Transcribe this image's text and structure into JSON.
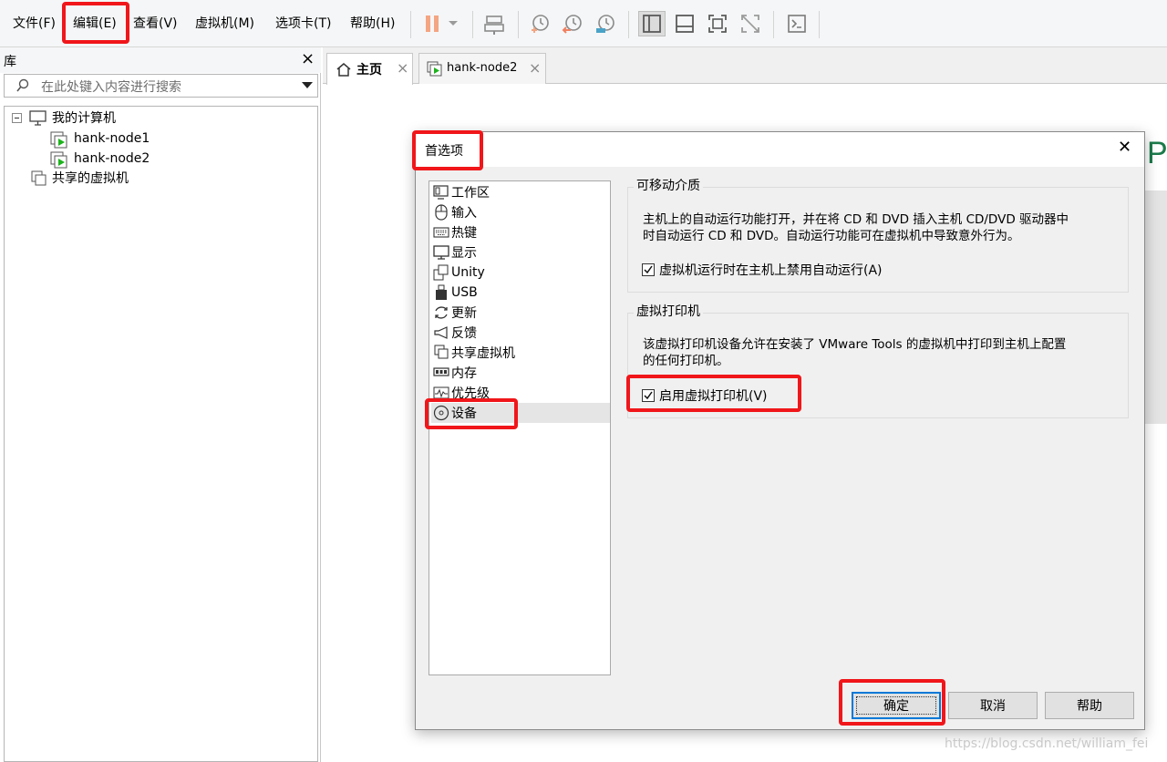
{
  "menubar": {
    "items": [
      "文件(F)",
      "编辑(E)",
      "查看(V)",
      "虚拟机(M)",
      "选项卡(T)",
      "帮助(H)"
    ]
  },
  "toolbar": {
    "icons": [
      "pause-icon",
      "dropdown-arrow-icon",
      "send-ctrl-alt-del-icon",
      "snapshot-icon",
      "revert-snapshot-icon",
      "snapshot-manager-icon",
      "show-library-icon",
      "thumbnail-bar-icon",
      "full-screen-icon",
      "unity-icon",
      "console-icon"
    ]
  },
  "library": {
    "title": "库",
    "close": "×",
    "search_placeholder": "在此处键入内容进行搜索",
    "tree": {
      "root": "我的计算机",
      "vms": [
        "hank-node1",
        "hank-node2"
      ],
      "shared": "共享的虚拟机"
    }
  },
  "tabs": [
    {
      "label": "主页",
      "close": "×"
    },
    {
      "label": "hank-node2",
      "close": "×"
    }
  ],
  "dialog": {
    "title": "首选项",
    "close": "✕",
    "categories": [
      "工作区",
      "输入",
      "热键",
      "显示",
      "Unity",
      "USB",
      "更新",
      "反馈",
      "共享虚拟机",
      "内存",
      "优先级",
      "设备"
    ],
    "selected_category": "设备",
    "removable_media": {
      "title": "可移动介质",
      "desc_line1": "主机上的自动运行功能打开，并在将 CD 和 DVD 插入主机 CD/DVD 驱动器中",
      "desc_line2": "时自动运行 CD 和 DVD。自动运行功能可在虚拟机中导致意外行为。",
      "checkbox_label": "虚拟机运行时在主机上禁用自动运行(A)",
      "checked": true
    },
    "virtual_printer": {
      "title": "虚拟打印机",
      "desc_line1": "该虚拟打印机设备允许在安装了 VMware Tools 的虚拟机中打印到主机上配置",
      "desc_line2": "的任何打印机。",
      "checkbox_label": "启用虚拟打印机(V)",
      "checked": true
    },
    "buttons": {
      "ok": "确定",
      "cancel": "取消",
      "help": "帮助"
    }
  },
  "background_fragment": "P",
  "watermark": "https://blog.csdn.net/william_fei",
  "colors": {
    "highlight_red": "#f0161a",
    "vm_green": "#1db31d",
    "accent_blue": "#0078d7"
  }
}
